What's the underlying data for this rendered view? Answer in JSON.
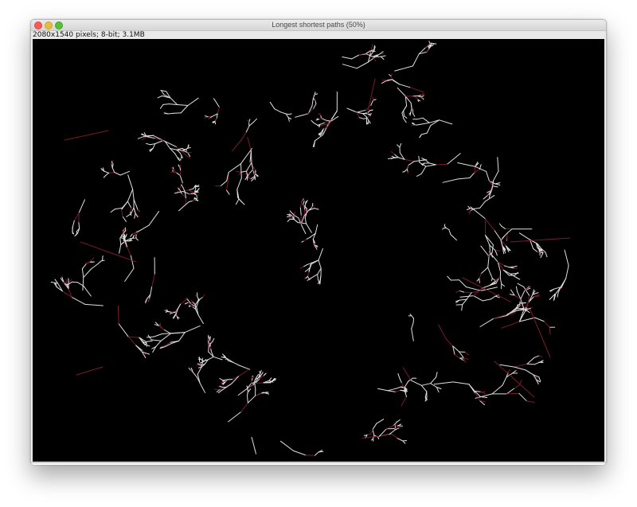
{
  "window": {
    "title": "Longest shortest paths (50%)",
    "info": "2080x1540 pixels; 8-bit; 3.1MB"
  },
  "buttons": {
    "close_icon": "close-icon",
    "minimize_icon": "minimize-icon",
    "zoom_icon": "zoom-icon"
  },
  "image": {
    "background": "#000000",
    "branch_color": "#e0e0e0",
    "longest_path_color": "#7a1a2e"
  }
}
